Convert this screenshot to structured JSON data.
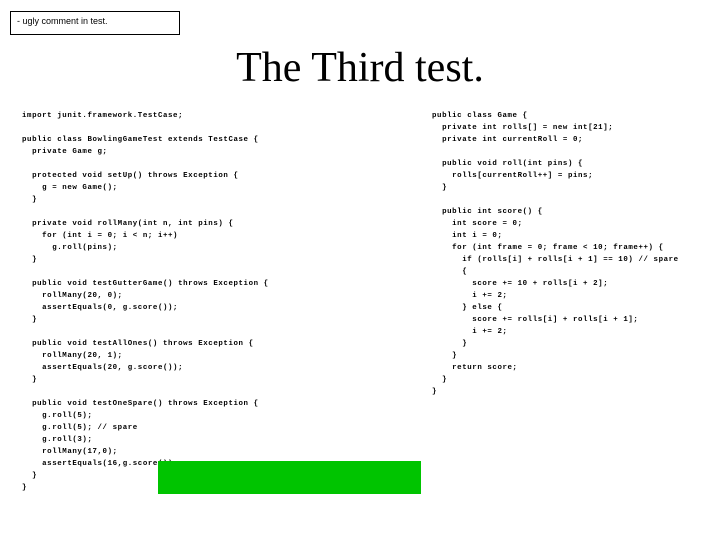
{
  "callout": {
    "text": "- ugly comment in test."
  },
  "title": "The Third test.",
  "code_left": "import junit.framework.TestCase;\n\npublic class BowlingGameTest extends TestCase {\n  private Game g;\n\n  protected void setUp() throws Exception {\n    g = new Game();\n  }\n\n  private void rollMany(int n, int pins) {\n    for (int i = 0; i < n; i++)\n      g.roll(pins);\n  }\n\n  public void testGutterGame() throws Exception {\n    rollMany(20, 0);\n    assertEquals(0, g.score());\n  }\n\n  public void testAllOnes() throws Exception {\n    rollMany(20, 1);\n    assertEquals(20, g.score());\n  }\n\n  public void testOneSpare() throws Exception {\n    g.roll(5);\n    g.roll(5); // spare\n    g.roll(3);\n    rollMany(17,0);\n    assertEquals(16,g.score());\n  }\n}",
  "code_right": "public class Game {\n  private int rolls[] = new int[21];\n  private int currentRoll = 0;\n\n  public void roll(int pins) {\n    rolls[currentRoll++] = pins;\n  }\n\n  public int score() {\n    int score = 0;\n    int i = 0;\n    for (int frame = 0; frame < 10; frame++) {\n      if (rolls[i] + rolls[i + 1] == 10) // spare\n      {\n        score += 10 + rolls[i + 2];\n        i += 2;\n      } else {\n        score += rolls[i] + rolls[i + 1];\n        i += 2;\n      }\n    }\n    return score;\n  }\n}"
}
